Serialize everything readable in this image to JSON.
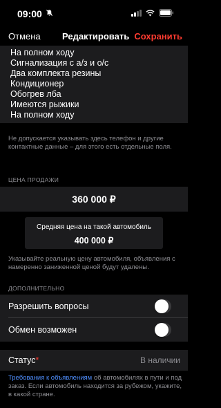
{
  "status_bar": {
    "time": "09:00",
    "bell_icon": "bell-slash-icon"
  },
  "nav": {
    "cancel": "Отмена",
    "title": "Редактировать",
    "save": "Сохранить"
  },
  "description": {
    "lines": [
      "На полном ходу",
      "Сигнализация с а/з и о/с",
      "Два комплекта резины",
      "Кондиционер",
      "Обогрев лба",
      "Имеются рыжики",
      "На полном ходу"
    ],
    "hint": "Не допускается указывать здесь телефон и другие контактные данные – для этого есть отдельные поля."
  },
  "price": {
    "header": "ЦЕНА ПРОДАЖИ",
    "value": "360 000 ₽",
    "avg_label": "Средняя цена на такой автомобиль",
    "avg_value": "400 000 ₽",
    "hint": "Указывайте реальную цену автомобиля, объявления с намеренно заниженной ценой будут удалены."
  },
  "extra": {
    "header": "ДОПОЛНИТЕЛЬНО",
    "allow_questions": "Разрешить вопросы",
    "allow_questions_on": false,
    "exchange": "Обмен возможен",
    "exchange_on": false
  },
  "status": {
    "label": "Статус",
    "required_mark": "*",
    "value": "В наличии"
  },
  "footer": {
    "link": "Требования к объявлениям",
    "text": " об автомобилях в пути и под заказ. Если автомобиль находится за рубежом, укажите, в какой стране."
  },
  "colors": {
    "accent_red": "#ff3b30",
    "link_blue": "#4f8fff",
    "cell_bg": "#1c1c1e"
  }
}
